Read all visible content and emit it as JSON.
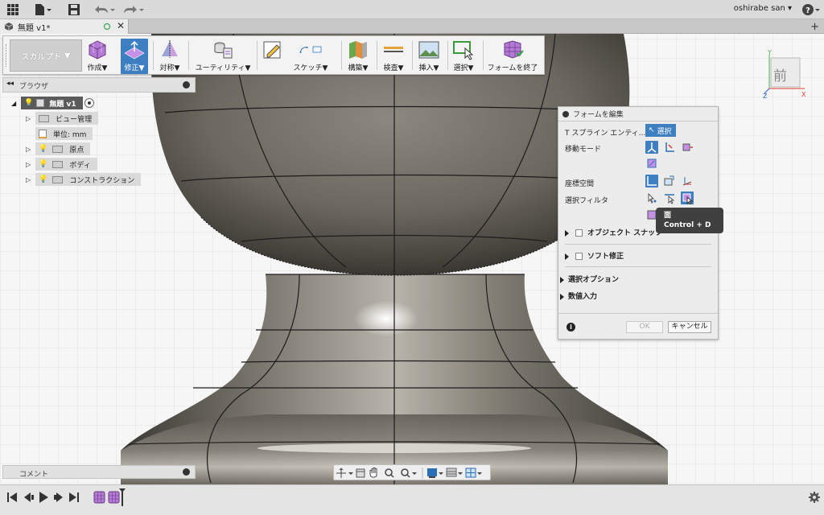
{
  "appbar": {
    "user": "oshirabe san"
  },
  "document": {
    "tab_title": "無題 v1*"
  },
  "toolbar": {
    "workspace": "スカルプト",
    "buttons": [
      {
        "label": "作成▼",
        "icon": "create-box-icon"
      },
      {
        "label": "修正▼",
        "icon": "modify-icon",
        "active": true
      },
      {
        "label": "対称▼",
        "icon": "symmetry-icon"
      },
      {
        "label": "ユーティリティ▼",
        "icon": "utility-icon"
      },
      {
        "label": "スケッチ▼",
        "icon": "sketch-icon"
      },
      {
        "label": "構築▼",
        "icon": "construct-icon"
      },
      {
        "label": "検査▼",
        "icon": "inspect-icon"
      },
      {
        "label": "挿入▼",
        "icon": "insert-icon"
      },
      {
        "label": "選択▼",
        "icon": "select-icon"
      },
      {
        "label": "フォームを終了",
        "icon": "finish-form-icon"
      }
    ]
  },
  "browser": {
    "title": "ブラウザ",
    "items": [
      {
        "label": "無題 v1"
      },
      {
        "label": "ビュー管理"
      },
      {
        "label": "単位: mm"
      },
      {
        "label": "原点"
      },
      {
        "label": "ボディ"
      },
      {
        "label": "コンストラクション"
      }
    ]
  },
  "navcube": {
    "face": "前"
  },
  "panel": {
    "title": "フォームを編集",
    "tspline_label": "T スプライン エンティ...",
    "select_button": "選択",
    "move_mode_label": "移動モード",
    "coord_space_label": "座標空間",
    "select_filter_label": "選択フィルタ",
    "object_snap_label": "オブジェクト スナップ",
    "soft_modify_label": "ソフト修正",
    "select_options_label": "選択オプション",
    "numeric_input_label": "数値入力",
    "ok_label": "OK",
    "cancel_label": "キャンセル"
  },
  "tooltip": {
    "title": "面",
    "shortcut": "Control + D"
  },
  "comments": {
    "title": "コメント"
  },
  "colors": {
    "accent": "#3d7fc1",
    "toolbar_bg": "#f3f3f3",
    "model_shade": "#6e6a62"
  }
}
